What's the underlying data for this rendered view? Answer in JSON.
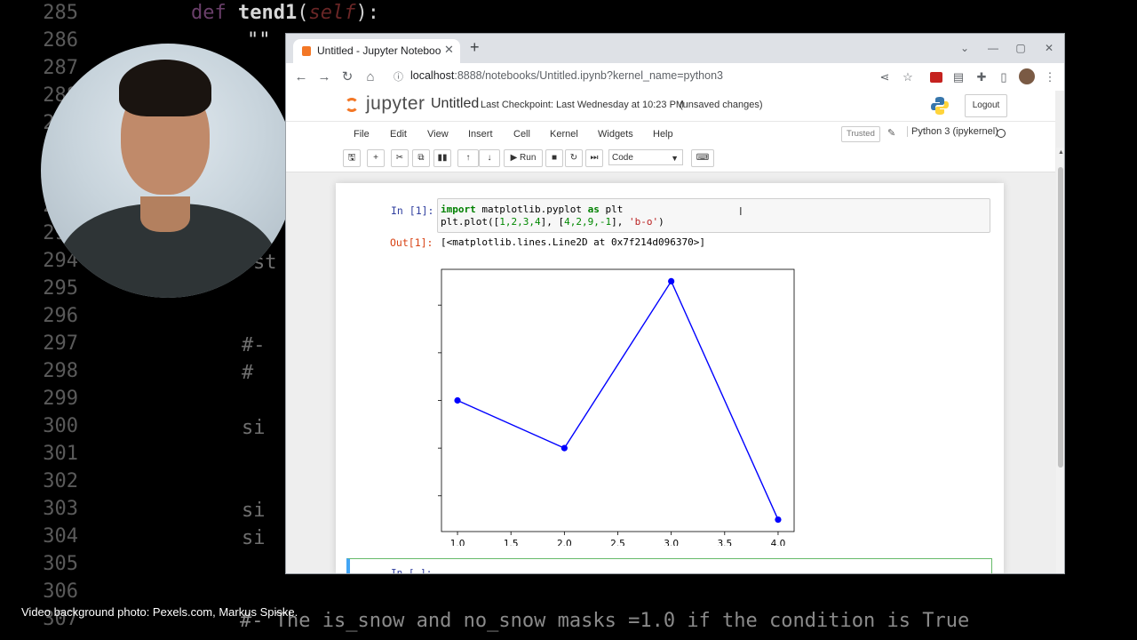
{
  "background_editor": {
    "line_numbers": [
      "285",
      "286",
      "287",
      "288",
      "289",
      "290",
      "291",
      "292",
      "293",
      "294",
      "295",
      "296",
      "297",
      "298",
      "299",
      "300",
      "301",
      "302",
      "303",
      "304",
      "305",
      "306",
      "307"
    ],
    "def_keyword": "def",
    "def_name": "tend1",
    "def_open": "(",
    "def_self": "self",
    "def_close": "):",
    "docstring": "\"\"",
    "frag_294": "st",
    "frag_297": "#-",
    "frag_298": "#",
    "frag_300": "si",
    "frag_303": "si",
    "frag_304": "si",
    "bottom_line": "#- The is_snow and no_snow masks =1.0 if the condition is True"
  },
  "caption": "Video background photo:  Pexels.com, Markus Spiske.",
  "browser": {
    "tab_title": "Untitled - Jupyter Notebook",
    "tab_close": "✕",
    "new_tab": "+",
    "window_controls": [
      "⌄",
      "—",
      "▢",
      "✕"
    ],
    "nav": [
      "←",
      "→",
      "↻",
      "⌂"
    ],
    "url_host": "localhost",
    "url_rest": ":8888/notebooks/Untitled.ipynb?kernel_name=python3",
    "toolbar_icons": [
      "⋖",
      "☆",
      "",
      "▤",
      "✚",
      "▯",
      "",
      "⋮"
    ]
  },
  "jupyter": {
    "logo_text": "jupyter",
    "notebook_name": "Untitled",
    "checkpoint": "Last Checkpoint: Last Wednesday at 10:23 PM",
    "unsaved": "(unsaved changes)",
    "logout": "Logout",
    "menu": [
      "File",
      "Edit",
      "View",
      "Insert",
      "Cell",
      "Kernel",
      "Widgets",
      "Help"
    ],
    "trusted": "Trusted",
    "kernel": "Python 3 (ipykernel)",
    "toolbar_buttons": [
      "🖫",
      "+",
      "✂",
      "⧉",
      "▮▮",
      "↑",
      "↓"
    ],
    "run_label": "▶ Run",
    "stop_icon": "■",
    "restart_icon": "↻",
    "fast_forward_icon": "⏭",
    "cell_type": "Code",
    "keyboard_icon": "⌨"
  },
  "cell1": {
    "prompt_in": "In [1]:",
    "code_line1_kw1": "import",
    "code_line1_mid": " matplotlib.pyplot ",
    "code_line1_kw2": "as",
    "code_line1_end": " plt",
    "code_line2_a": "plt.plot([",
    "code_line2_n1": "1,2,3,4",
    "code_line2_b": "], [",
    "code_line2_n2": "4,2,9,-1",
    "code_line2_c": "], ",
    "code_line2_s": "'b-o'",
    "code_line2_d": ")",
    "prompt_out": "Out[1]:",
    "output_text": "[<matplotlib.lines.Line2D at 0x7f214d096370>]"
  },
  "cell2": {
    "prompt_in": "In [ ]:"
  },
  "chart_data": {
    "type": "line",
    "x": [
      1,
      2,
      3,
      4
    ],
    "series": [
      {
        "values": [
          4,
          2,
          9,
          -1
        ]
      }
    ],
    "line_color": "#0000ff",
    "marker": "o",
    "xlim": [
      0.85,
      4.15
    ],
    "ylim": [
      -1.5,
      9.5
    ],
    "xticks": [
      "1.0",
      "1.5",
      "2.0",
      "2.5",
      "3.0",
      "3.5",
      "4.0"
    ],
    "yticks": [
      "0",
      "2",
      "4",
      "6",
      "8"
    ],
    "title": "",
    "xlabel": "",
    "ylabel": "",
    "grid": false
  }
}
